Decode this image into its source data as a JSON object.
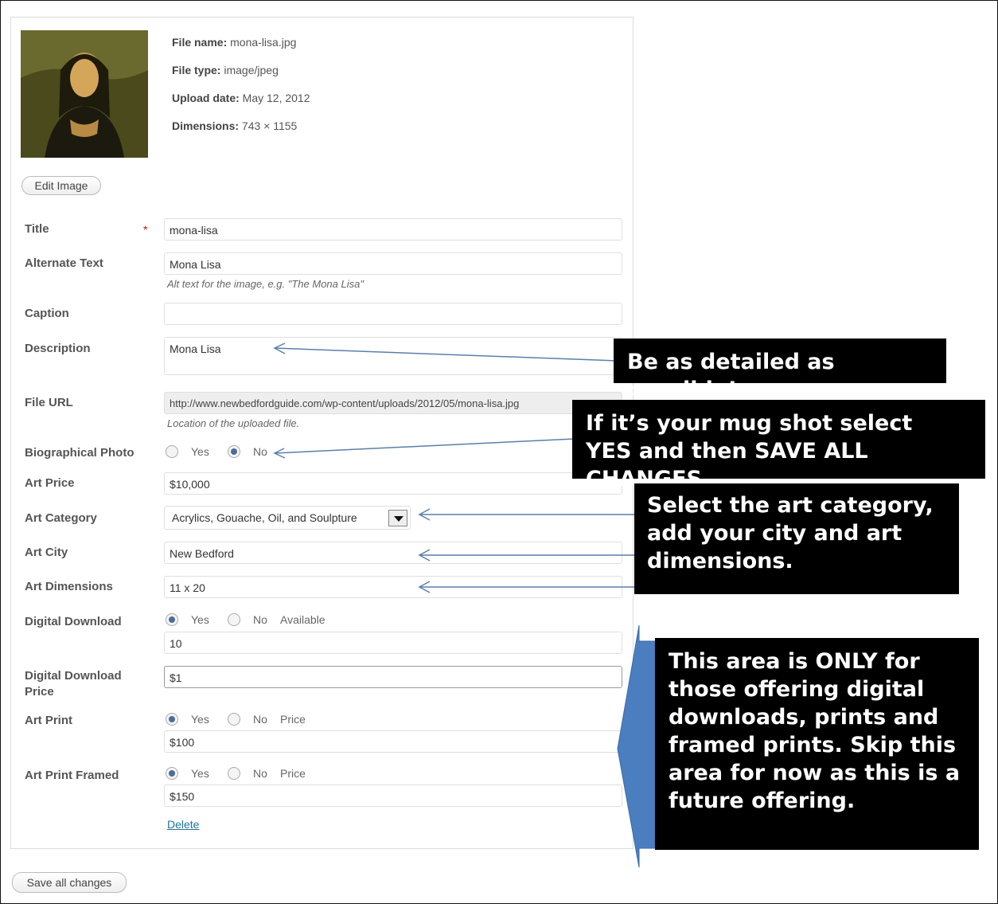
{
  "file_info": {
    "file_name_label": "File name:",
    "file_name": "mona-lisa.jpg",
    "file_type_label": "File type:",
    "file_type": "image/jpeg",
    "upload_date_label": "Upload date:",
    "upload_date": "May 12, 2012",
    "dimensions_label": "Dimensions:",
    "dimensions": "743 × 1155"
  },
  "buttons": {
    "edit_image": "Edit Image",
    "save_all": "Save all changes"
  },
  "form": {
    "title_label": "Title",
    "title_required": "*",
    "title_value": "mona-lisa",
    "alt_label": "Alternate Text",
    "alt_value": "Mona Lisa",
    "alt_hint": "Alt text for the image, e.g. \"The Mona Lisa\"",
    "caption_label": "Caption",
    "caption_value": "",
    "description_label": "Description",
    "description_value": "Mona Lisa",
    "file_url_label": "File URL",
    "file_url_value": "http://www.newbedfordguide.com/wp-content/uploads/2012/05/mona-lisa.jpg",
    "file_url_hint": "Location of the uploaded file.",
    "bio_label": "Biographical Photo",
    "bio_yes": "Yes",
    "bio_no": "No",
    "price_label": "Art Price",
    "price_value": "$10,000",
    "category_label": "Art Category",
    "category_value": "Acrylics, Gouache, Oil, and Soulpture",
    "city_label": "Art City",
    "city_value": "New Bedford",
    "dims_label": "Art Dimensions",
    "dims_value": "11 x 20",
    "dl_label": "Digital Download",
    "dl_yes": "Yes",
    "dl_no": "No",
    "dl_available": "Available",
    "dl_value": "10",
    "dlp_label_1": "Digital Download",
    "dlp_label_2": "Price",
    "dlp_value": "$1",
    "print_label": "Art Print",
    "print_yes": "Yes",
    "print_no": "No",
    "print_price": "Price",
    "print_value": "$100",
    "framed_label": "Art Print Framed",
    "framed_yes": "Yes",
    "framed_no": "No",
    "framed_price": "Price",
    "framed_value": "$150",
    "delete_link": "Delete"
  },
  "callouts": {
    "detail": "Be as detailed as possible!",
    "mugshot_1": "If it’s your mug shot select",
    "mugshot_2": "YES and then SAVE ALL CHANGES.",
    "category_1": "Select the art category,",
    "category_2": "add your city and art",
    "category_3": "dimensions.",
    "digital_1": "This area is ONLY for",
    "digital_2": "those offering digital",
    "digital_3": "downloads, prints and",
    "digital_4": "framed prints. Skip this",
    "digital_5": "area for now as this is a",
    "digital_6": "future offering."
  },
  "colors": {
    "callout_bg": "#000000",
    "arrow_fill": "#4a7ebf",
    "line_color": "#5b7fa8"
  }
}
